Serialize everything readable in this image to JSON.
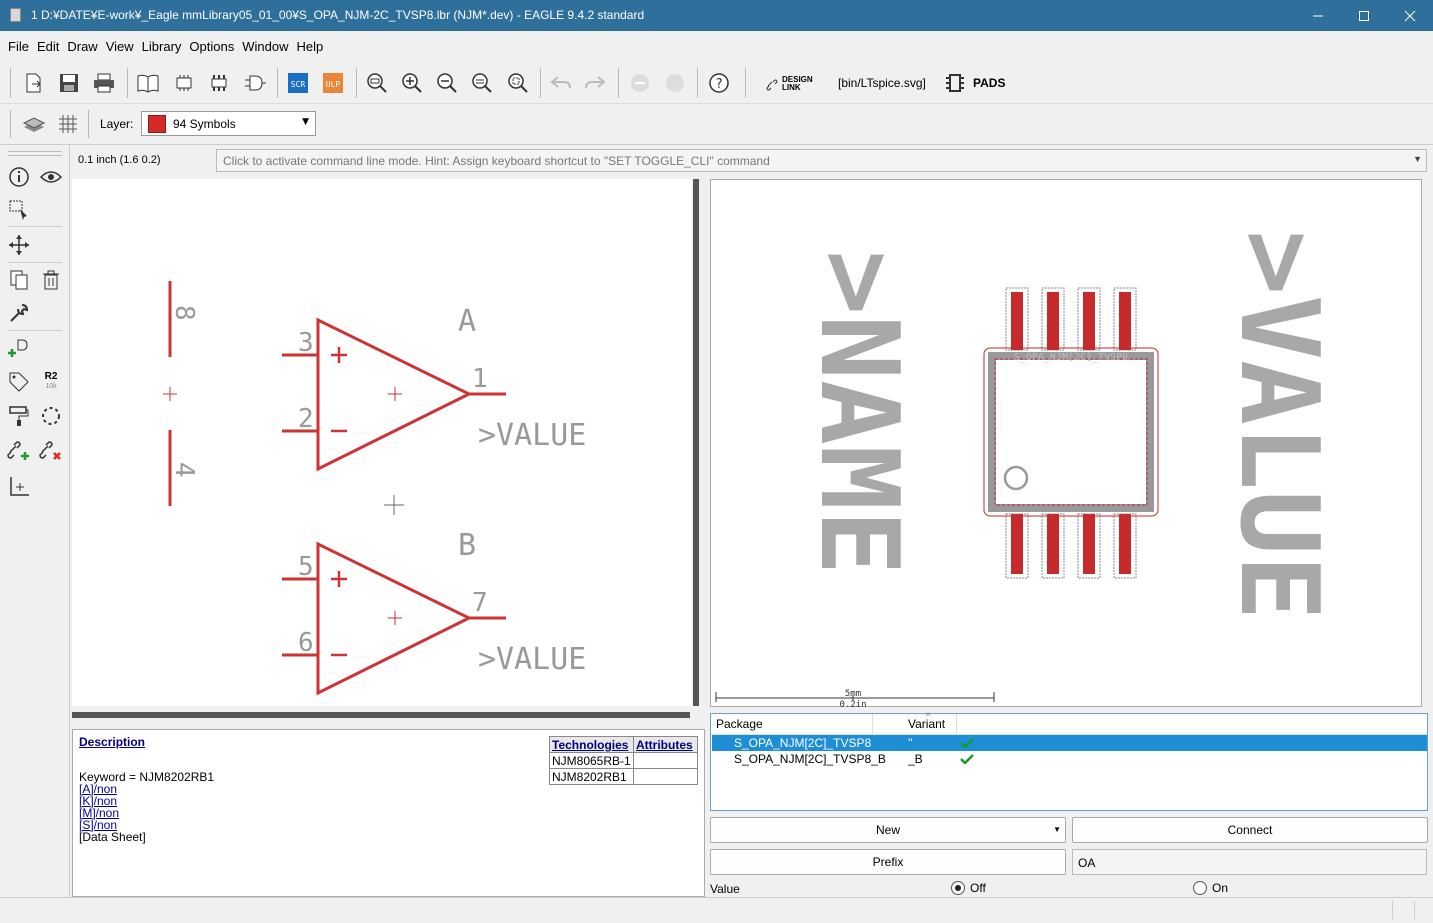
{
  "window": {
    "title": "1 D:¥DATE¥E-work¥_Eagle mmLibrary05_01_00¥S_OPA_NJM-2C_TVSP8.lbr (NJM*.dev) - EAGLE 9.4.2 standard"
  },
  "menu": [
    "File",
    "Edit",
    "Draw",
    "View",
    "Library",
    "Options",
    "Window",
    "Help"
  ],
  "toolbar": {
    "scr_label": "SCR",
    "ulp_label": "ULP",
    "design_link_label": "DESIGN LINK",
    "ltspice_label": "[bin/LTspice.svg]",
    "pads_label": "PADS"
  },
  "layer": {
    "label": "Layer:",
    "value": "94 Symbols",
    "color": "#d42a2a"
  },
  "left_tools": {
    "r2_label": "R2",
    "r2_sub": "10k"
  },
  "grid_status": "0.1 inch (1.6 0.2)",
  "command_line": {
    "hint": "Click to activate command line mode. Hint: Assign keyboard shortcut to \"SET TOGGLE_CLI\" command"
  },
  "schematic": {
    "gate_a": {
      "name": "A",
      "pin_plus": "3",
      "pin_minus": "2",
      "pin_out": "1",
      "value": ">VALUE"
    },
    "gate_b": {
      "name": "B",
      "pin_plus": "5",
      "pin_minus": "6",
      "pin_out": "7",
      "value": ">VALUE"
    },
    "power": {
      "pin_top": "8",
      "pin_bottom": "4"
    },
    "color": "#cc3333"
  },
  "package_view": {
    "name_text": ">NAME",
    "value_text": ">VALUE",
    "package_label": "S_OPA_NJM[2C]_TVSP8",
    "scale_top": "5mm",
    "scale_bottom": "0.2in"
  },
  "description": {
    "title": "Description",
    "keyword": "Keyword = NJM8202RB1",
    "links": [
      "[A]/non",
      "[K]/non",
      "[M]/non",
      "[S]/non"
    ],
    "datasheet": "[Data Sheet]",
    "table": {
      "headers": [
        "Technologies",
        "Attributes"
      ],
      "rows": [
        [
          "NJM8065RB-1",
          ""
        ],
        [
          "NJM8202RB1",
          ""
        ]
      ]
    }
  },
  "packages": {
    "headers": {
      "package": "Package",
      "variant": "Variant"
    },
    "rows": [
      {
        "package": "S_OPA_NJM[2C]_TVSP8",
        "variant": "''",
        "selected": true
      },
      {
        "package": "S_OPA_NJM[2C]_TVSP8_B",
        "variant": "_B",
        "selected": false
      }
    ]
  },
  "buttons": {
    "new": "New",
    "connect": "Connect",
    "prefix": "Prefix"
  },
  "prefix_value": "OA",
  "value_setting": {
    "label": "Value",
    "off": "Off",
    "on": "On",
    "selected": "Off"
  }
}
